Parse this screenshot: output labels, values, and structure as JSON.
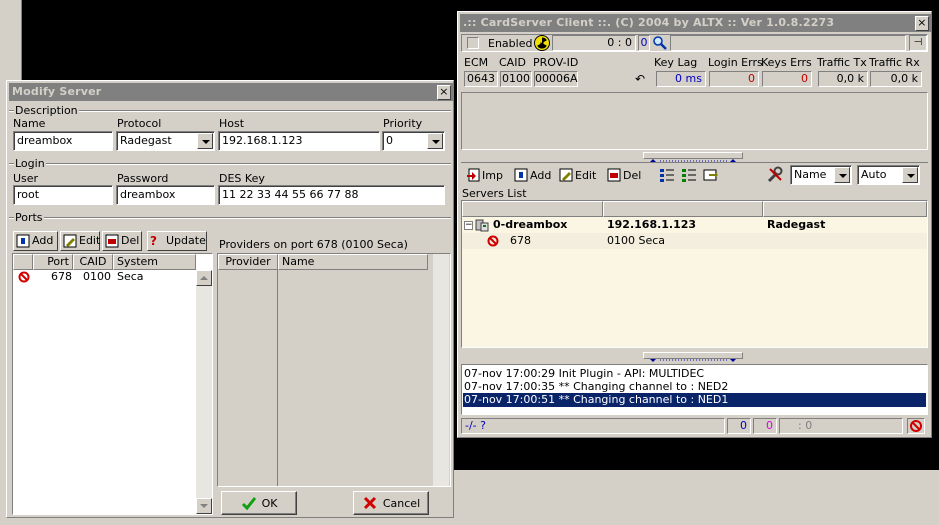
{
  "modify_dialog": {
    "title": "Modify Server",
    "close_glyph": "×",
    "description_group": "Description",
    "name_label": "Name",
    "name_value": "dreambox",
    "protocol_label": "Protocol",
    "protocol_value": "Radegast",
    "host_label": "Host",
    "host_value": "192.168.1.123",
    "priority_label": "Priority",
    "priority_value": "0",
    "login_group": "Login",
    "user_label": "User",
    "user_value": "root",
    "password_label": "Password",
    "password_value": "dreambox",
    "deskey_label": "DES Key",
    "deskey_value": "11 22 33 44 55 66 77 88",
    "ports_group": "Ports",
    "add_label": "Add",
    "edit_label": "Edit",
    "del_label": "Del",
    "update_label": "Update",
    "ports_columns": [
      "Port",
      "CAID",
      "System"
    ],
    "ports_rows": [
      {
        "port": "678",
        "caid": "0100",
        "system": "Seca"
      }
    ],
    "providers_title": "Providers on port 678 (0100 Seca)",
    "providers_columns": [
      "Provider",
      "Name"
    ],
    "ok_label": "OK",
    "cancel_label": "Cancel"
  },
  "client": {
    "title": ".:: CardServer Client ::. (C) 2004 by ALTX :: Ver 1.0.8.2273",
    "close_glyph": "×",
    "enabled_label": "Enabled",
    "counter": "0 : 0",
    "counter_blue": "0",
    "pin_glyph": "⊣",
    "stat_headers": {
      "ecm": "ECM",
      "caid": "CAID",
      "provid": "PROV-ID",
      "keylag": "Key Lag",
      "login_errs": "Login Errs",
      "keys_errs": "Keys Errs",
      "traffic_tx": "Traffic Tx",
      "traffic_rx": "Traffic Rx"
    },
    "stat_values": {
      "ecm": "0643",
      "caid": "0100",
      "provid": "00006A",
      "keylag": "0 ms",
      "login_errs": "0",
      "keys_errs": "0",
      "traffic_tx": "0,0 k",
      "traffic_rx": "0,0 k"
    },
    "toolbar": {
      "imp": "Imp",
      "add": "Add",
      "edit": "Edit",
      "del": "Del",
      "sort_value": "Name",
      "mode_value": "Auto"
    },
    "servers_list_label": "Servers List",
    "server": {
      "name": "0-dreambox",
      "host": "192.168.1.123",
      "protocol": "Radegast",
      "port": "678",
      "system": "0100 Seca"
    },
    "log": [
      "07-nov 17:00:29 Init Plugin - API: MULTIDEC",
      "07-nov 17:00:35 ** Changing channel to : NED2",
      "07-nov 17:00:51 ** Changing channel to : NED1"
    ],
    "status": {
      "left": "-/-",
      "q": "?",
      "blue": "0",
      "magenta": "0",
      "ratio": ": 0"
    }
  },
  "colors": {
    "face": "#d4d0c8",
    "titlebar_inactive": "#808080",
    "selection": "#0a246a",
    "server_row_bg": "#fbf6e4"
  }
}
